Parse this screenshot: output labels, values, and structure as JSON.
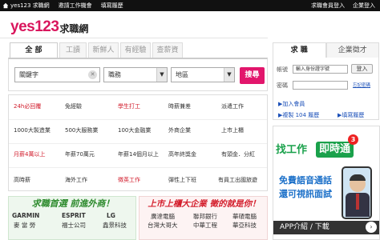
{
  "topbar": {
    "brand": "yes123 求職網",
    "links": [
      "邀請工作機會",
      "填寫履歷"
    ],
    "right": [
      "求職會員登入",
      "企業登入"
    ]
  },
  "logo": {
    "brand": "yes123",
    "suffix": "求職網"
  },
  "tabs": [
    "全 部",
    "工讀",
    "新鮮人",
    "有經驗",
    "查薪資"
  ],
  "search": {
    "keyword": "關鍵字",
    "category": "職務",
    "area": "地區",
    "button": "搜尋"
  },
  "categories": [
    [
      "24h必回覆",
      "免經驗",
      "學生打工",
      "時薪兼差",
      "派遣工作"
    ],
    [
      "1000大製造業",
      "500大服務業",
      "100大金融業",
      "外商企業",
      "上市上櫃"
    ],
    [
      "月薪4萬以上",
      "年薪70萬元",
      "年薪14個月以上",
      "高年終獎金",
      "有頭金．分紅"
    ],
    [
      "高時薪",
      "海外工作",
      "徵英工作",
      "彈性上下班",
      "有員工出國旅遊"
    ]
  ],
  "right_tabs": [
    "求 職",
    "企業徵才"
  ],
  "login": {
    "account_label": "帳號",
    "account_placeholder": "輸入身份證字號",
    "password_label": "密碼",
    "login_button": "登入",
    "forgot": "忘記密碼",
    "join": "▶加入會員",
    "resume_count": "▶複製 104 履歷",
    "fill_resume": "▶填寫履歷"
  },
  "ad_left": {
    "title": "求職首選 前進外商！",
    "rows": [
      [
        "GARMIN",
        "ESPRIT",
        "LG"
      ],
      [
        "麥 當 勞",
        "福士公司",
        "鑫景科技"
      ]
    ]
  },
  "ad_right": {
    "title": "上市上櫃大企業 徵的就是你！",
    "rows": [
      [
        "廣達電腦",
        "聯邦銀行",
        "華碩電腦"
      ],
      [
        "台灣大哥大",
        "中華工程",
        "華亞科技"
      ]
    ]
  },
  "app_banner": {
    "find": "找工作",
    "instant": "即時通",
    "badge": "3",
    "line1": "免費語音通話",
    "line2": "還可視訊面試",
    "app": "APP介紹 / 下載",
    "arrow": "›"
  }
}
